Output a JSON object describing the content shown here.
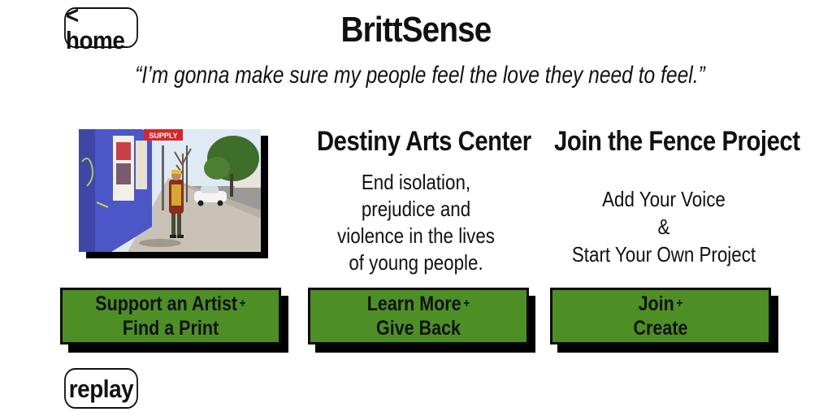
{
  "nav": {
    "home_label": "< home",
    "replay_label": "replay"
  },
  "header": {
    "title": "BrittSense",
    "quote": "“I’m gonna make sure my people feel the love they need to feel.”"
  },
  "columns": {
    "artist": {
      "button_line1": "Support an Artist",
      "button_line2": "Find a Print",
      "plus": "+"
    },
    "destiny": {
      "title": "Destiny Arts Center",
      "description_lines": [
        "End isolation,",
        "prejudice and",
        "violence in the lives",
        "of young people."
      ],
      "button_line1": "Learn More",
      "button_line2": "Give Back",
      "plus": "+"
    },
    "fence": {
      "title": "Join the Fence Project",
      "description_lines": [
        "Add Your Voice",
        "&",
        "Start Your Own Project"
      ],
      "button_line1": "Join",
      "button_line2": "Create",
      "plus": "+"
    }
  },
  "photo": {
    "sign_text": "SUPPLY"
  },
  "colors": {
    "button_green": "#4e8f25",
    "ink": "#111111"
  }
}
